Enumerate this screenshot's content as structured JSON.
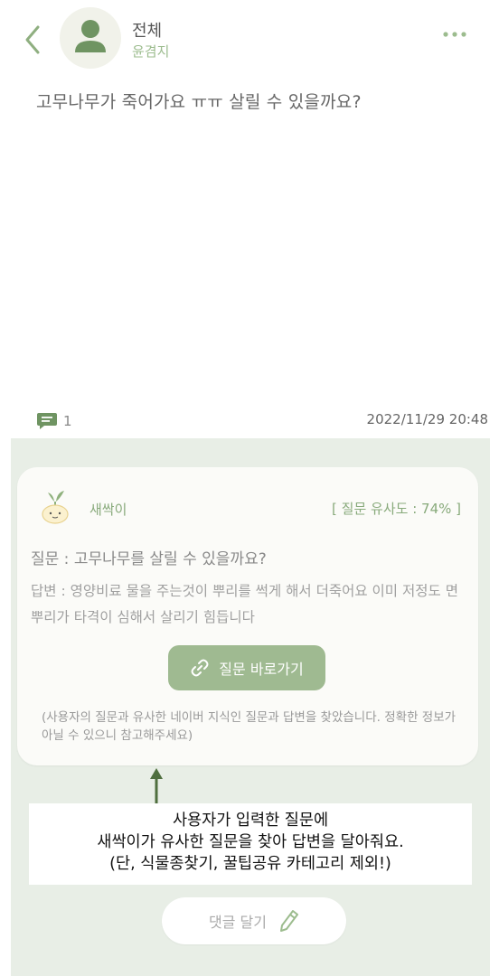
{
  "header": {
    "category": "전체",
    "author": "윤겸지"
  },
  "post": {
    "text": "고무나무가 죽어가요 ㅠㅠ 살릴 수 있을까요?",
    "comment_count": "1",
    "date": "2022/11/29 20:48"
  },
  "ai_card": {
    "name": "새싹이",
    "similarity": "[ 질문 유사도 : 74% ]",
    "question": "질문 : 고무나무를 살릴 수 있을까요?",
    "answer": "답변 : 영양비료 물을 주는것이 뿌리를 썩게 해서 더죽어요 이미 저정도 면 뿌리가 타격이 심해서 살리기 힘듭니다",
    "link_label": "질문 바로가기",
    "disclaimer": "(사용자의 질문과 유사한 네이버 지식인 질문과 답변을 찾았습니다. 정확한 정보가 아닐 수 있으니 참고해주세요)"
  },
  "annotation": {
    "line1": "사용자가 입력한 질문에",
    "line2": "새싹이가 유사한 질문을 찾아 답변을 달아줘요.",
    "line3": "(단, 식물종찾기, 꿀팁공유 카테고리 제외!)"
  },
  "reply": {
    "label": "댓글 달기"
  },
  "colors": {
    "accent": "#9fba91",
    "panel": "#e8eee6",
    "arrow": "#4f6f3f"
  },
  "icons": [
    "back-chevron-icon",
    "user-icon",
    "more-dots-icon",
    "comment-icon",
    "sprout-icon",
    "link-icon",
    "pencil-icon",
    "arrow-up-icon"
  ]
}
